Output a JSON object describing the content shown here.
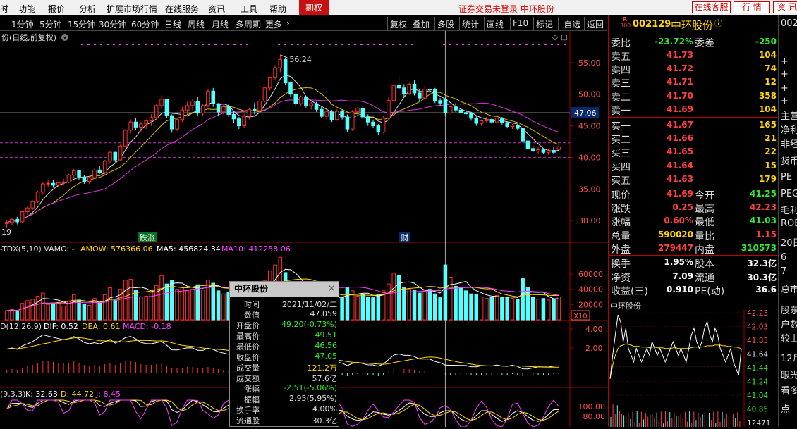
{
  "menu": {
    "items": [
      "时",
      "功能",
      "报价",
      "分析",
      "扩展市场行情",
      "在线服务",
      "资讯",
      "工具",
      "帮助"
    ],
    "qiquan": "期权",
    "notice": "证券交易未登录  中环股份",
    "right_buttons": [
      "在线客服",
      "行  情",
      "资  讯"
    ]
  },
  "toolbar": {
    "periods": [
      "1分钟",
      "5分钟",
      "15分钟",
      "30分钟",
      "60分钟",
      "日线",
      "周线",
      "月线",
      "多周期",
      "更多"
    ],
    "active": "日线",
    "tools": [
      "复权",
      "叠加",
      "多股",
      "统计",
      "画线",
      "F10",
      "标记",
      "-自选",
      "返回"
    ]
  },
  "main_chart": {
    "title": "份(日线,前复权)",
    "y_ticks": [
      "55.00",
      "50.00",
      "45.00",
      "40.00",
      "35.00",
      "30.00"
    ],
    "cursor_price": "47.06",
    "max_label": "56.24",
    "min_label": "19",
    "markers": [
      "跌涨",
      "财"
    ]
  },
  "volume_chart": {
    "legend": {
      "name": "-TDX(5,10) VAMO: -",
      "amow": "AMOW: 576366.06",
      "ma5": "MA5: 456824.34",
      "ma10": "MA10: 412258.06"
    },
    "y_ticks": [
      "60000",
      "40000",
      "20000"
    ],
    "unit": "X10"
  },
  "macd_chart": {
    "legend": {
      "name": "D(12,26,9)",
      "dif": "DIF: 0.52",
      "dea": "DEA: 0.61",
      "macd": "MACD: -0.18"
    },
    "y_ticks": [
      "4.00",
      "2.00"
    ]
  },
  "kdj_chart": {
    "legend": {
      "name": "(9,3,3)",
      "k": "K: 32.63",
      "d": "D: 44.72",
      "j": "J: 8.45"
    },
    "y_ticks": [
      "100.00",
      "80.00"
    ]
  },
  "quote": {
    "badge": "R",
    "badge2": "300",
    "code": "002129",
    "name": "中环股份",
    "weibi_label": "委比",
    "weibi": "-23.72%",
    "weicha_label": "委差",
    "weicha": "-250",
    "asks": [
      {
        "label": "卖五",
        "price": "41.73",
        "vol": "104"
      },
      {
        "label": "卖四",
        "price": "41.72",
        "vol": "74"
      },
      {
        "label": "卖三",
        "price": "41.71",
        "vol": "12"
      },
      {
        "label": "卖二",
        "price": "41.70",
        "vol": "358"
      },
      {
        "label": "卖一",
        "price": "41.69",
        "vol": "104"
      }
    ],
    "bids": [
      {
        "label": "买一",
        "price": "41.67",
        "vol": "165"
      },
      {
        "label": "买二",
        "price": "41.66",
        "vol": "21"
      },
      {
        "label": "买三",
        "price": "41.65",
        "vol": "22"
      },
      {
        "label": "买四",
        "price": "41.64",
        "vol": "15"
      },
      {
        "label": "买五",
        "price": "41.63",
        "vol": "179"
      }
    ],
    "stats": [
      {
        "l1": "现价",
        "v1": "41.69",
        "c1": "red",
        "l2": "今开",
        "v2": "41.25",
        "c2": "green"
      },
      {
        "l1": "涨跌",
        "v1": "0.25",
        "c1": "red",
        "l2": "最高",
        "v2": "42.23",
        "c2": "red"
      },
      {
        "l1": "涨幅",
        "v1": "0.60%",
        "c1": "red",
        "l2": "最低",
        "v2": "41.03",
        "c2": "green"
      },
      {
        "l1": "总量",
        "v1": "590020",
        "c1": "yel",
        "l2": "量比",
        "v2": "1.15",
        "c2": "red"
      },
      {
        "l1": "外盘",
        "v1": "279447",
        "c1": "red",
        "l2": "内盘",
        "v2": "310573",
        "c2": "green"
      }
    ],
    "stats2": [
      {
        "l1": "换手",
        "v1": "1.95%",
        "l2": "股本",
        "v2": "32.3亿"
      },
      {
        "l1": "净资",
        "v1": "7.09",
        "l2": "流通",
        "v2": "30.3亿"
      },
      {
        "l1": "收益(三)",
        "v1": "0.910",
        "l2": "PE(动)",
        "v2": "36.6"
      }
    ]
  },
  "intraday": {
    "title": "中环股份",
    "y_ticks": [
      "42.23",
      "42.03",
      "41.83",
      "41.64",
      "41.44",
      "41.24",
      "41.04",
      "40.85",
      "12471"
    ]
  },
  "far_right": [
    "002",
    "+",
    "+",
    "+",
    "+",
    "主营",
    "净利",
    "非经",
    "货币",
    "PE",
    "PEG",
    "毛利",
    "ROE",
    "20日",
    "6",
    "7",
    "总市",
    "股东",
    "户数",
    "较上",
    "12月",
    "眼光",
    "看多",
    "点"
  ],
  "tooltip": {
    "title": "中环股份",
    "rows": [
      {
        "label": "时间",
        "value": "2021/11/02/二",
        "color": "#dddddd"
      },
      {
        "label": "数值",
        "value": "47.059",
        "color": "#dddddd"
      },
      {
        "label": "开盘价",
        "value": "49.20(-0.73%)",
        "color": "#2eea2e"
      },
      {
        "label": "最高价",
        "value": "49.51",
        "color": "#2eea2e"
      },
      {
        "label": "最低价",
        "value": "46.56",
        "color": "#2eea2e"
      },
      {
        "label": "收盘价",
        "value": "47.05",
        "color": "#2eea2e"
      },
      {
        "label": "成交量",
        "value": "121.2万",
        "color": "#ffd700"
      },
      {
        "label": "成交额",
        "value": "57.6亿",
        "color": "#dddddd"
      },
      {
        "label": "涨幅",
        "value": "-2.51(-5.06%)",
        "color": "#2eea2e"
      },
      {
        "label": "振幅",
        "value": "2.95(5.95%)",
        "color": "#dddddd"
      },
      {
        "label": "换手率",
        "value": "4.00%",
        "color": "#dddddd"
      },
      {
        "label": "流通股",
        "value": "30.3亿",
        "color": "#dddddd"
      }
    ]
  },
  "colors": {
    "up": "#ff3030",
    "down": "#54ffff",
    "ma5": "#ffffff",
    "ma10": "#ffd700",
    "ma20": "#ff40ff",
    "grid": "#a00000"
  },
  "chart_data": {
    "type": "candlestick",
    "title": "份(日线,前复权)",
    "ylim": [
      27,
      58
    ],
    "y_ticks": [
      55,
      50,
      45,
      40,
      35,
      30
    ],
    "candles": [
      [
        29.5,
        30.0,
        28.8,
        29.7
      ],
      [
        29.7,
        30.4,
        29.2,
        30.2
      ],
      [
        30.2,
        30.6,
        29.4,
        29.8
      ],
      [
        29.8,
        31.6,
        29.6,
        31.4
      ],
      [
        31.4,
        32.2,
        30.9,
        32.0
      ],
      [
        32.0,
        33.2,
        31.7,
        33.0
      ],
      [
        33.0,
        34.7,
        32.8,
        34.5
      ],
      [
        34.5,
        36.1,
        34.2,
        35.8
      ],
      [
        35.8,
        36.5,
        35.3,
        35.9
      ],
      [
        35.9,
        36.4,
        35.2,
        35.6
      ],
      [
        35.6,
        36.2,
        35.3,
        36.0
      ],
      [
        36.0,
        36.6,
        35.6,
        36.1
      ],
      [
        36.1,
        37.4,
        35.9,
        37.2
      ],
      [
        37.2,
        38.2,
        36.8,
        37.9
      ],
      [
        37.9,
        38.0,
        36.4,
        36.9
      ],
      [
        36.9,
        37.2,
        35.8,
        36.2
      ],
      [
        36.2,
        37.0,
        35.8,
        36.8
      ],
      [
        36.8,
        38.2,
        36.6,
        38.0
      ],
      [
        38.0,
        38.6,
        37.4,
        37.6
      ],
      [
        37.6,
        39.6,
        37.3,
        39.4
      ],
      [
        39.4,
        41.0,
        39.0,
        40.8
      ],
      [
        40.8,
        40.9,
        39.2,
        39.6
      ],
      [
        39.6,
        42.0,
        39.5,
        41.8
      ],
      [
        41.8,
        44.5,
        41.6,
        44.3
      ],
      [
        44.3,
        46.0,
        43.8,
        45.6
      ],
      [
        45.6,
        46.3,
        44.3,
        44.8
      ],
      [
        44.8,
        45.6,
        44.0,
        45.3
      ],
      [
        45.3,
        46.0,
        44.5,
        45.8
      ],
      [
        45.8,
        46.8,
        45.0,
        46.3
      ],
      [
        46.3,
        48.5,
        46.0,
        48.2
      ],
      [
        48.2,
        49.8,
        47.6,
        49.2
      ],
      [
        49.2,
        49.3,
        46.2,
        46.6
      ],
      [
        46.6,
        46.8,
        43.9,
        44.5
      ],
      [
        44.5,
        46.2,
        44.2,
        46.0
      ],
      [
        46.0,
        48.0,
        45.6,
        47.5
      ],
      [
        47.5,
        48.8,
        46.8,
        48.2
      ],
      [
        48.2,
        49.3,
        47.5,
        48.9
      ],
      [
        48.9,
        49.6,
        46.5,
        47.0
      ],
      [
        47.0,
        48.5,
        46.6,
        48.2
      ],
      [
        48.2,
        50.8,
        47.9,
        50.5
      ],
      [
        50.5,
        51.0,
        48.0,
        48.5
      ],
      [
        48.5,
        48.6,
        46.6,
        47.2
      ],
      [
        47.2,
        48.5,
        46.8,
        48.0
      ],
      [
        48.0,
        48.5,
        46.4,
        46.8
      ],
      [
        46.8,
        47.3,
        45.5,
        46.1
      ],
      [
        46.1,
        46.4,
        44.5,
        45.0
      ],
      [
        45.0,
        46.9,
        44.7,
        46.5
      ],
      [
        46.5,
        47.9,
        46.0,
        47.6
      ],
      [
        47.6,
        48.6,
        46.8,
        47.4
      ],
      [
        47.4,
        49.2,
        47.0,
        48.9
      ],
      [
        48.9,
        51.2,
        48.7,
        51.0
      ],
      [
        51.0,
        52.8,
        50.6,
        52.6
      ],
      [
        52.6,
        54.6,
        52.2,
        54.2
      ],
      [
        54.2,
        56.24,
        53.5,
        55.5
      ],
      [
        55.5,
        55.8,
        51.4,
        51.8
      ],
      [
        51.8,
        52.0,
        49.5,
        50.0
      ],
      [
        50.0,
        50.4,
        48.0,
        48.5
      ],
      [
        48.5,
        49.8,
        48.2,
        49.6
      ],
      [
        49.6,
        49.7,
        47.8,
        48.2
      ],
      [
        48.2,
        48.8,
        47.6,
        48.5
      ],
      [
        48.5,
        48.8,
        47.2,
        47.6
      ],
      [
        47.6,
        48.0,
        46.2,
        46.5
      ],
      [
        46.5,
        47.5,
        46.0,
        47.2
      ],
      [
        47.2,
        47.5,
        45.6,
        46.0
      ],
      [
        46.0,
        47.6,
        45.8,
        47.3
      ],
      [
        47.3,
        47.6,
        46.0,
        46.4
      ],
      [
        46.4,
        46.8,
        44.0,
        44.5
      ],
      [
        44.5,
        47.5,
        44.2,
        47.2
      ],
      [
        47.2,
        48.0,
        46.8,
        47.8
      ],
      [
        47.8,
        48.2,
        46.0,
        46.4
      ],
      [
        46.4,
        46.8,
        45.0,
        45.6
      ],
      [
        45.6,
        46.0,
        44.6,
        45.0
      ],
      [
        45.0,
        45.3,
        43.5,
        44.0
      ],
      [
        44.0,
        46.6,
        43.8,
        46.2
      ],
      [
        46.2,
        49.5,
        46.0,
        49.0
      ],
      [
        49.0,
        51.8,
        48.8,
        51.4
      ],
      [
        51.4,
        52.8,
        50.6,
        51.0
      ],
      [
        51.0,
        51.6,
        49.6,
        50.1
      ],
      [
        50.1,
        51.8,
        49.9,
        51.6
      ],
      [
        51.6,
        52.2,
        49.8,
        50.2
      ],
      [
        50.2,
        50.8,
        48.8,
        49.4
      ],
      [
        49.4,
        51.3,
        49.2,
        50.8
      ],
      [
        50.8,
        52.4,
        50.2,
        50.7
      ],
      [
        50.7,
        51.0,
        48.6,
        49.0
      ],
      [
        49.0,
        49.4,
        48.2,
        48.6
      ],
      [
        49.2,
        49.51,
        46.56,
        47.05
      ],
      [
        47.05,
        48.2,
        46.9,
        48.0
      ],
      [
        48.0,
        48.6,
        47.2,
        47.5
      ],
      [
        47.5,
        47.9,
        46.8,
        47.1
      ],
      [
        47.1,
        47.6,
        46.6,
        46.9
      ],
      [
        46.9,
        47.2,
        45.8,
        46.2
      ],
      [
        46.2,
        46.5,
        45.0,
        45.4
      ],
      [
        45.4,
        46.0,
        45.0,
        45.8
      ],
      [
        45.8,
        46.4,
        45.5,
        46.0
      ],
      [
        46.0,
        46.2,
        45.3,
        45.6
      ],
      [
        45.6,
        46.5,
        45.4,
        46.2
      ],
      [
        46.2,
        46.4,
        45.2,
        45.5
      ],
      [
        45.5,
        45.7,
        44.6,
        44.9
      ],
      [
        44.9,
        45.3,
        44.5,
        45.1
      ],
      [
        45.1,
        45.2,
        44.4,
        44.6
      ],
      [
        44.6,
        44.7,
        42.3,
        42.6
      ],
      [
        42.6,
        42.8,
        41.2,
        41.4
      ],
      [
        41.4,
        41.8,
        40.8,
        41.0
      ],
      [
        41.0,
        41.6,
        40.5,
        41.2
      ],
      [
        41.2,
        41.4,
        40.6,
        40.8
      ],
      [
        40.8,
        41.3,
        40.4,
        41.1
      ],
      [
        41.1,
        41.6,
        40.6,
        40.8
      ],
      [
        41.25,
        42.23,
        41.03,
        41.69
      ]
    ],
    "ref_lines": [
      47.06,
      42.3,
      40.0
    ],
    "volume": [
      120,
      135,
      110,
      215,
      250,
      270,
      310,
      350,
      200,
      220,
      210,
      180,
      240,
      330,
      260,
      200,
      190,
      280,
      220,
      330,
      420,
      260,
      400,
      520,
      530,
      390,
      300,
      310,
      360,
      450,
      580,
      470,
      520,
      400,
      430,
      380,
      400,
      460,
      390,
      520,
      480,
      380,
      340,
      360,
      330,
      380,
      320,
      340,
      330,
      420,
      510,
      640,
      720,
      820,
      620,
      480,
      410,
      380,
      360,
      330,
      300,
      310,
      290,
      300,
      280,
      300,
      420,
      380,
      310,
      330,
      300,
      290,
      330,
      380,
      470,
      610,
      580,
      420,
      400,
      390,
      350,
      380,
      400,
      340,
      290,
      720,
      560,
      440,
      420,
      380,
      340,
      330,
      300,
      280,
      300,
      320,
      290,
      300,
      280,
      270,
      540,
      420,
      300,
      270,
      280,
      260,
      270,
      300
    ],
    "macd": [
      0.4,
      0.5,
      0.4,
      0.7,
      0.9,
      1.1,
      1.4,
      1.7,
      1.6,
      1.5,
      1.4,
      1.3,
      1.4,
      1.6,
      1.4,
      1.1,
      1.0,
      1.1,
      1.0,
      1.2,
      1.4,
      1.1,
      1.3,
      1.6,
      1.7,
      1.5,
      1.2,
      1.1,
      1.1,
      1.2,
      1.3,
      1.0,
      0.6,
      0.6,
      0.7,
      0.8,
      0.8,
      0.6,
      0.6,
      0.8,
      0.7,
      0.5,
      0.4,
      0.3,
      0.2,
      0.0,
      0.0,
      0.1,
      0.1,
      0.3,
      0.5,
      0.8,
      1.1,
      1.3,
      1.0,
      0.6,
      0.3,
      0.2,
      0.1,
      0.0,
      -0.1,
      -0.2,
      -0.2,
      -0.3,
      -0.2,
      -0.3,
      -0.5,
      -0.3,
      -0.2,
      -0.3,
      -0.4,
      -0.4,
      -0.5,
      -0.3,
      0.1,
      0.5,
      0.6,
      0.5,
      0.5,
      0.4,
      0.2,
      0.2,
      0.2,
      0.0,
      -0.1,
      -0.3,
      -0.3,
      -0.3,
      -0.3,
      -0.3,
      -0.4,
      -0.4,
      -0.3,
      -0.3,
      -0.3,
      -0.2,
      -0.3,
      -0.3,
      -0.2,
      -0.3,
      -0.5,
      -0.5,
      -0.4,
      -0.3,
      -0.3,
      -0.3,
      -0.2,
      -0.18
    ],
    "intraday_price": [
      41.25,
      41.6,
      41.9,
      42.2,
      42.1,
      41.8,
      42.0,
      41.7,
      41.6,
      41.5,
      41.7,
      41.6,
      41.5,
      41.6,
      41.7,
      41.6,
      41.8,
      41.7,
      41.6,
      41.7,
      41.6,
      41.5,
      41.6,
      41.7,
      41.8,
      41.7,
      41.6,
      41.7,
      41.6,
      41.5,
      41.7,
      41.9,
      42.0,
      41.8,
      41.7,
      41.8,
      42.0,
      42.1,
      41.9,
      41.8,
      42.0,
      41.9,
      41.7,
      41.6,
      41.5,
      41.6,
      41.7,
      41.5,
      41.4,
      41.3,
      41.69
    ],
    "intraday_avg": [
      41.25,
      41.45,
      41.6,
      41.7,
      41.74,
      41.75,
      41.77,
      41.76,
      41.75,
      41.73,
      41.73,
      41.73,
      41.72,
      41.72,
      41.72,
      41.71,
      41.72,
      41.72,
      41.71,
      41.71,
      41.71,
      41.7,
      41.7,
      41.7,
      41.71,
      41.71,
      41.7,
      41.7,
      41.7,
      41.7,
      41.7,
      41.71,
      41.72,
      41.72,
      41.72,
      41.72,
      41.73,
      41.74,
      41.74,
      41.74,
      41.75,
      41.75,
      41.75,
      41.74,
      41.74,
      41.73,
      41.73,
      41.72,
      41.72,
      41.71,
      41.7
    ]
  }
}
